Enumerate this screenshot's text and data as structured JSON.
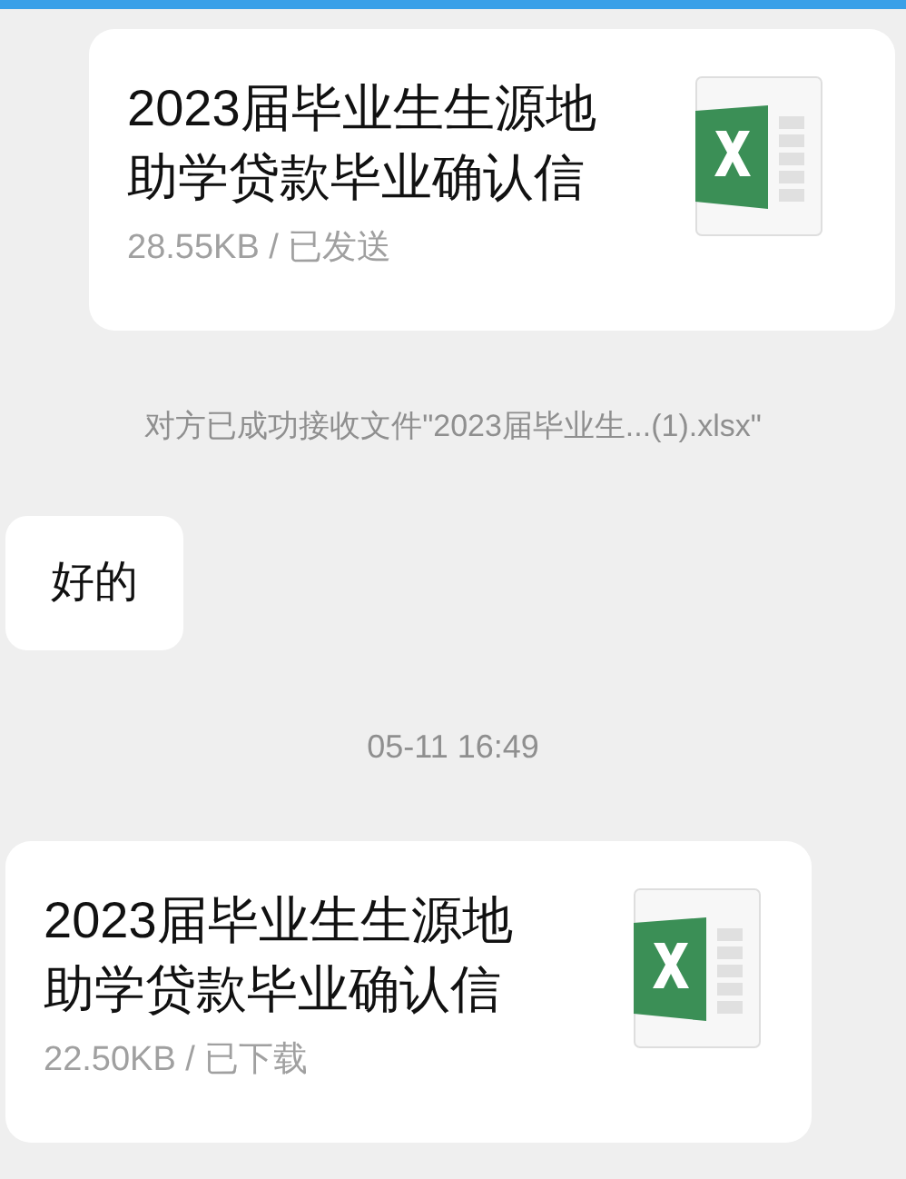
{
  "messages": [
    {
      "kind": "file",
      "outgoing": true,
      "title": "2023届毕业生生源地助学贷款毕业确认信",
      "meta": "28.55KB / 已发送"
    },
    {
      "kind": "notice",
      "text": "对方已成功接收文件\"2023届毕业生...(1).xlsx\""
    },
    {
      "kind": "text",
      "outgoing": false,
      "text": "好的"
    },
    {
      "kind": "time",
      "text": "05-11 16:49"
    },
    {
      "kind": "file",
      "outgoing": false,
      "title": "2023届毕业生生源地助学贷款毕业确认信",
      "meta": "22.50KB / 已下载"
    }
  ]
}
